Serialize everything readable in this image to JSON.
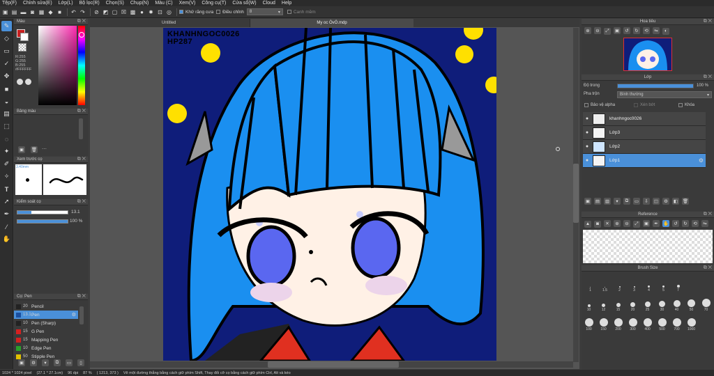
{
  "menu": [
    "Tệp(F)",
    "Chỉnh sửa(E)",
    "Lớp(L)",
    "Bộ lọc(R)",
    "Chọn(S)",
    "Chụp(N)",
    "Màu (C)",
    "Xem(V)",
    "Công cụ(T)",
    "Cửa sổ(W)",
    "Cloud",
    "Help"
  ],
  "toolbar": {
    "anti_alias": "Khử răng cưa",
    "adjust": "Điều chỉnh",
    "adjust_value": "8",
    "edge_label": "Canh mềm"
  },
  "tabs": {
    "untitled": "Untitled",
    "active": "My oc ÒvÓ.mdp"
  },
  "color_panel": {
    "title": "Màu",
    "r": "R:255",
    "g": "G:255",
    "b": "B:255",
    "hex": "#FFFFFF"
  },
  "palette_panel": {
    "title": "Bảng màu"
  },
  "brush_preview": {
    "title": "Xem trước cọ",
    "size": "3.40mm"
  },
  "brush_control": {
    "title": "Kiểm soát cọ",
    "size_value": "13.1",
    "opacity_value": "100 %"
  },
  "brush_list": {
    "title": "Cọ: Pen",
    "items": [
      {
        "size": "20",
        "name": "Pencil",
        "color": "#222222"
      },
      {
        "size": "13.1",
        "name": "Pen",
        "color": "#1a4fa0"
      },
      {
        "size": "10",
        "name": "Pen (Sharp)",
        "color": "#222222"
      },
      {
        "size": "15",
        "name": "G Pen",
        "color": "#d42020"
      },
      {
        "size": "15",
        "name": "Mapping Pen",
        "color": "#d42020"
      },
      {
        "size": "10",
        "name": "Edge Pen",
        "color": "#2aa02a"
      },
      {
        "size": "50",
        "name": "Stipple Pen",
        "color": "#e0c000"
      }
    ]
  },
  "navigator": {
    "title": "Hoa tiêu"
  },
  "layers": {
    "title": "Lớp",
    "opacity_label": "Độ trong",
    "opacity_value": "100 %",
    "opacity": 1.0,
    "blend_label": "Pha trộn",
    "blend_value": "Bình thường",
    "protect_alpha": "Bảo vệ alpha",
    "clipping": "Xén bớt",
    "lock": "Khóa",
    "items": [
      {
        "name": "khanhngoc0026"
      },
      {
        "name": "Lớp3"
      },
      {
        "name": "Lớp2"
      },
      {
        "name": "Lớp1"
      }
    ]
  },
  "reference": {
    "title": "Reference"
  },
  "brush_size": {
    "title": "Brush Size",
    "row1": [
      "1",
      "1.5",
      "2",
      "3",
      "4",
      "5",
      "7"
    ],
    "row2": [
      "10",
      "12",
      "15",
      "20",
      "25",
      "30",
      "40",
      "50",
      "70"
    ],
    "row3": [
      "100",
      "150",
      "200",
      "300",
      "400",
      "500",
      "700",
      "1000"
    ]
  },
  "watermark": {
    "line1": "KHANHNGOC0026",
    "line2": "HP287"
  },
  "status": {
    "size": "1024 * 1024 pixel",
    "dims": "(27.1 * 27.1cm)",
    "dpi": "96 dpi",
    "zoom": "87 %",
    "coords": "( 1213, 373 )",
    "hint": "Vẽ một đường thẳng bằng cách giữ phím Shift, Thay đổi cỡ cọ bằng cách giữ phím Ctrl, Alt và kéo"
  },
  "colors": {
    "accent": "#4a90d9",
    "hair": "#1a8ff0",
    "bg": "#0f1d7a",
    "dots": "#ffe000"
  }
}
